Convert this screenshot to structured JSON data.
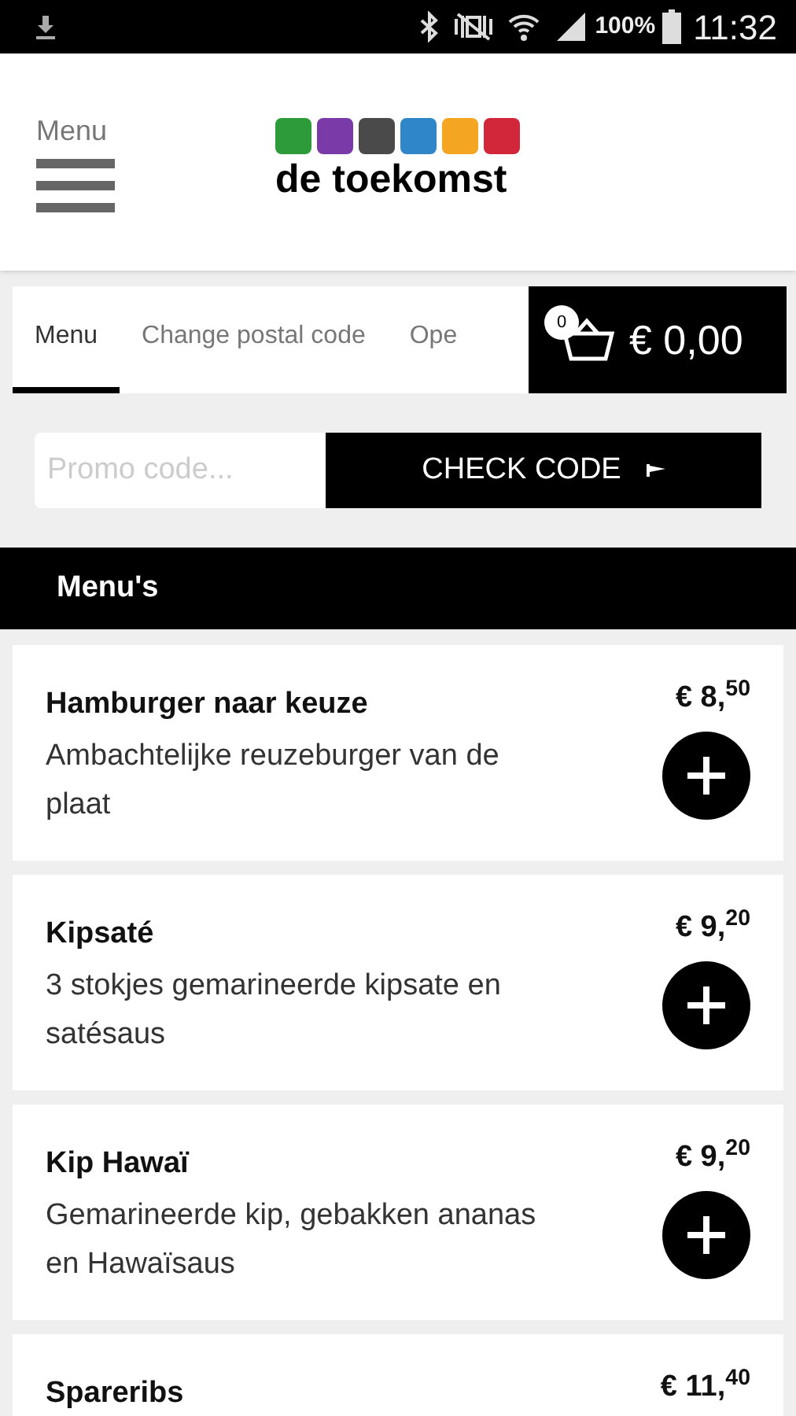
{
  "status_bar": {
    "battery": "100%",
    "time": "11:32"
  },
  "header": {
    "menu_label": "Menu",
    "logo_text": "de toekomst"
  },
  "tabs": [
    {
      "label": "Menu",
      "selected": true
    },
    {
      "label": "Change postal code",
      "selected": false
    },
    {
      "label": "Ope",
      "selected": false
    }
  ],
  "cart": {
    "count": "0",
    "total": "€ 0,00"
  },
  "promo": {
    "placeholder": "Promo code...",
    "button": "CHECK CODE"
  },
  "section_title": "Menu's",
  "items": [
    {
      "name": "Hamburger naar keuze",
      "description": "Ambachtelijke reuzeburger van de plaat",
      "price": "€ 8,$^{50}$"
    },
    {
      "name": "Kipsaté",
      "description": "3 stokjes gemarineerde kipsate en satésaus",
      "price": "€ 9,$^{20}$"
    },
    {
      "name": "Kip Hawaï",
      "description": "Gemarineerde kip, gebakken ananas en Hawaïsaus",
      "price": "€ 9,$^{20}$"
    },
    {
      "name": "Spareribs",
      "price": "€ 11,$^{40}$"
    }
  ]
}
